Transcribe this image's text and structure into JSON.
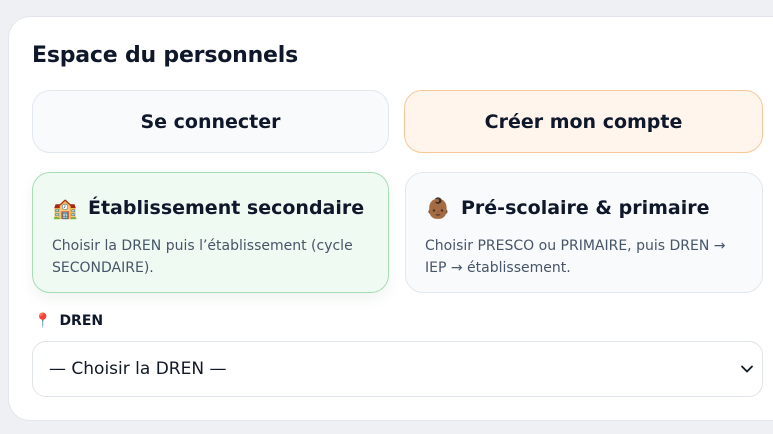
{
  "section": {
    "title": "Espace du personnels"
  },
  "tabs": {
    "login_label": "Se connecter",
    "create_label": "Créer mon compte"
  },
  "options": [
    {
      "icon": "school-building-icon",
      "title": "Établissement secondaire",
      "description": "Choisir la DREN puis l’établissement (cycle SECONDAIRE)."
    },
    {
      "icon": "baby-icon",
      "title": "Pré-scolaire & primaire",
      "description": "Choisir PRESCO ou PRIMAIRE, puis DREN → IEP → établissement."
    }
  ],
  "dren_field": {
    "icon": "pin-icon",
    "label": "DREN",
    "selected_value": "— Choisir la DREN —"
  },
  "colors": {
    "accent_orange_bg": "#fff5ec",
    "accent_orange_border": "#f6c79a",
    "selected_green_bg": "#effaf2",
    "selected_green_border": "#a7dcb4"
  }
}
